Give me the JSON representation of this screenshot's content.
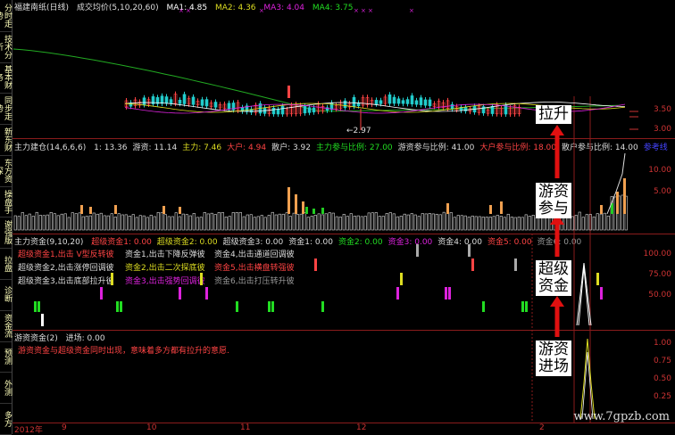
{
  "sidebar": {
    "tabs": [
      "分时走势",
      "技术分析",
      "基本财务",
      "同步走势",
      "新东财",
      "东方资深",
      "操盘手",
      "谢强版",
      "拉盘",
      "诊断",
      "资金流",
      "预测",
      "外测",
      "多方"
    ]
  },
  "main_header": {
    "title": "福建南纸(日线)",
    "indicator": "成交均价(5,10,20,60)",
    "ma1": "MA1: 4.85",
    "ma2": "MA2: 4.36",
    "ma3": "MA3: 4.04",
    "ma4": "MA4: 3.75",
    "low_mark": "←2.97"
  },
  "main_axis": [
    "3.50",
    "3.00"
  ],
  "pane2_header": {
    "title": "主力建仓(14,6,6,6)",
    "items": [
      {
        "text": "1: 13.36",
        "color": "#dddddd"
      },
      {
        "text": "游资: 11.14",
        "color": "#dddddd"
      },
      {
        "text": "主力: 7.46",
        "color": "#dddd22"
      },
      {
        "text": "大户: 4.94",
        "color": "#ff4444"
      },
      {
        "text": "散户: 3.92",
        "color": "#dddddd"
      },
      {
        "text": "主力参与比例: 27.00",
        "color": "#22dd22"
      },
      {
        "text": "游资参与比例: 41.00",
        "color": "#dddddd"
      },
      {
        "text": "大户参与比例: 18.00",
        "color": "#ff4444"
      },
      {
        "text": "散户参与比例: 14.00",
        "color": "#dddddd"
      },
      {
        "text": "参考线",
        "color": "#4444ff"
      }
    ]
  },
  "pane2_axis": [
    "10.00",
    "5.00"
  ],
  "pane3_header": {
    "title": "主力资金(9,10,20)",
    "items": [
      {
        "text": "超级资金1: 0.00",
        "color": "#ff4444"
      },
      {
        "text": "超级资金2: 0.00",
        "color": "#dddd22"
      },
      {
        "text": "超级资金3: 0.00",
        "color": "#dddddd"
      },
      {
        "text": "资金1: 0.00",
        "color": "#dddddd"
      },
      {
        "text": "资金2: 0.00",
        "color": "#22dd22"
      },
      {
        "text": "资金3: 0.00",
        "color": "#dd22dd"
      },
      {
        "text": "资金4: 0.00",
        "color": "#dddddd"
      },
      {
        "text": "资金5: 0.00",
        "color": "#ff4444"
      },
      {
        "text": "资金6: 0.00",
        "color": "#999999"
      }
    ],
    "notes": [
      {
        "text": "超级资金1,出击 V型反转彼",
        "color": "#ff4444"
      },
      {
        "text": "资金1,出击下降反弹彼",
        "color": "#dddddd"
      },
      {
        "text": "资金4,出击通道回调彼",
        "color": "#dddddd"
      },
      {
        "text": "超级资金2,出击涨停回调彼",
        "color": "#dddddd"
      },
      {
        "text": "资金2,出击二次探底彼",
        "color": "#dddd22"
      },
      {
        "text": "资金5,出击横盘转强彼",
        "color": "#ff4444"
      },
      {
        "text": "超级资金3,出击底部拉升彼",
        "color": "#dddddd"
      },
      {
        "text": "资金3,出击强势回调彼",
        "color": "#dd22dd"
      },
      {
        "text": "资金6,出击打压转升彼",
        "color": "#999999"
      }
    ]
  },
  "pane3_axis": [
    "100.00",
    "75.00",
    "50.00"
  ],
  "pane4_header": {
    "title": "游资资金(2)",
    "label": "进场: 0.00",
    "note": "游资资金与超级资金同时出现，意味着多方都有拉升的意愿."
  },
  "pane4_axis": [
    "1.00",
    "0.75",
    "0.50",
    "0.25"
  ],
  "callouts": {
    "c1": [
      "拉升"
    ],
    "c2": [
      "游资",
      "参与"
    ],
    "c3": [
      "超级",
      "资金"
    ],
    "c4": [
      "游资",
      "进场"
    ]
  },
  "xaxis": [
    "2012年",
    "9",
    "10",
    "11",
    "12",
    "2"
  ],
  "watermark": "www.7gpzb.com",
  "colors": {
    "accent": "#cc2222",
    "up": "#ff4444",
    "down": "#22cccc"
  }
}
